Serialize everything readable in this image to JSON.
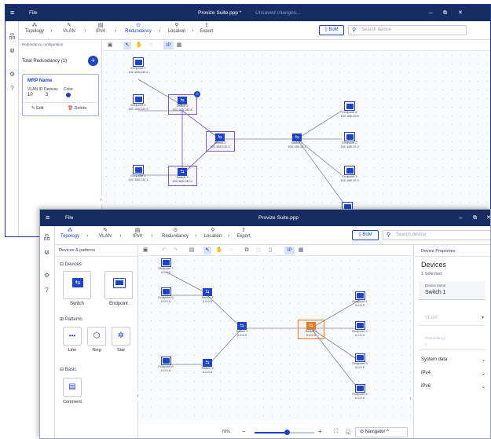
{
  "back": {
    "menu_icon": "menu-icon",
    "file": "File",
    "title": "Provize Suite.ppp *",
    "unsaved": "Unsaved changes...",
    "tabs": [
      {
        "label": "Topology",
        "icon": "topology-icon"
      },
      {
        "label": "VLAN",
        "icon": "wrench-icon"
      },
      {
        "label": "IPv4",
        "icon": "ipv4-icon"
      },
      {
        "label": "Redundancy",
        "icon": "redundancy-icon"
      },
      {
        "label": "Location",
        "icon": "location-icon"
      },
      {
        "label": "Export",
        "icon": "export-icon"
      }
    ],
    "bom": "BoM",
    "search_placeholder": "Search device",
    "panel_title": "Redundancy configuration",
    "total_label": "Total Redundancy (1)",
    "add": "+",
    "mrp_name": "MRP Name",
    "vlan_id_label": "VLAN ID",
    "devices_label": "Devices",
    "color_label": "Color",
    "vlan_id": "10",
    "devices": "3",
    "edit": "Edit",
    "delete": "Delete",
    "nodes": [
      {
        "name": "Endpoint 7",
        "ip": "192.168.132.2"
      },
      {
        "name": "Endpoint 4",
        "ip": "192.168.132.5"
      },
      {
        "name": "Switch 4",
        "ip": "192.168.132.6"
      },
      {
        "name": "Switch 2",
        "ip": "192.168.132.3"
      },
      {
        "name": "Switch 1",
        "ip": "192.168.10.1"
      },
      {
        "name": "Endpoint 5",
        "ip": "192.168.10.5"
      },
      {
        "name": "Endpoint 2",
        "ip": "192.168.10.2"
      },
      {
        "name": "Endpoint 3",
        "ip": "192.168.10.3"
      },
      {
        "name": "Endpoint 1",
        "ip": "192.168.132.1"
      },
      {
        "name": "Switch 3",
        "ip": "192.168.132.4"
      }
    ]
  },
  "front": {
    "file": "File",
    "title": "Provize Suite.ppp",
    "tabs": [
      {
        "label": "Topology",
        "icon": "topology-icon"
      },
      {
        "label": "VLAN",
        "icon": "wrench-icon"
      },
      {
        "label": "IPv4",
        "icon": "ipv4-icon"
      },
      {
        "label": "Redundancy",
        "icon": "redundancy-icon"
      },
      {
        "label": "Location",
        "icon": "location-icon"
      },
      {
        "label": "Export",
        "icon": "export-icon"
      }
    ],
    "bom": "BoM",
    "search_placeholder": "Search device",
    "panel_title": "Devices & patterns",
    "devices_header": "Devices",
    "switch": "Switch",
    "endpoint": "Endpoint",
    "patterns_header": "Patterns",
    "line": "Line",
    "ring": "Ring",
    "star": "Star",
    "basic_header": "Basic",
    "comment": "Comment",
    "nodes": [
      {
        "name": "Endpoint 7",
        "ip": "0.0.0.0"
      },
      {
        "name": "Endpoint 5",
        "ip": "0.0.0.0"
      },
      {
        "name": "Switch 4",
        "ip": "0.0.0.0"
      },
      {
        "name": "Switch 2",
        "ip": "0.0.0.0"
      },
      {
        "name": "Switch 1",
        "ip": "0.0.0.0"
      },
      {
        "name": "Endpoint 1",
        "ip": "0.0.0.0"
      },
      {
        "name": "Endpoint 2",
        "ip": "0.0.0.0"
      },
      {
        "name": "Endpoint 3",
        "ip": "0.0.0.0"
      },
      {
        "name": "Endpoint 6",
        "ip": "0.0.0.0"
      },
      {
        "name": "Switch 3",
        "ip": "0.0.0.0"
      },
      {
        "name": "Endpoint 4",
        "ip": "0.0.0.0"
      }
    ],
    "zoom": "78%",
    "minus": "−",
    "plus": "+",
    "zoom_level": 0.55,
    "navigator": "Navigator",
    "props": {
      "header": "Device Properties",
      "title": "Devices",
      "selected": "1 Selected",
      "device_name_label": "Device name",
      "device_name": "Switch 1",
      "vlan": "VLAN",
      "redundancy_label": "Redundancy",
      "redundancy_value": "/",
      "system_data": "System data",
      "ipv4": "IPv4",
      "ipv6": "IPv6"
    }
  },
  "colors": {
    "navy": "#172c61",
    "accent": "#1e44c4",
    "orange": "#e07b2a",
    "purple": "#7c5cc4"
  }
}
